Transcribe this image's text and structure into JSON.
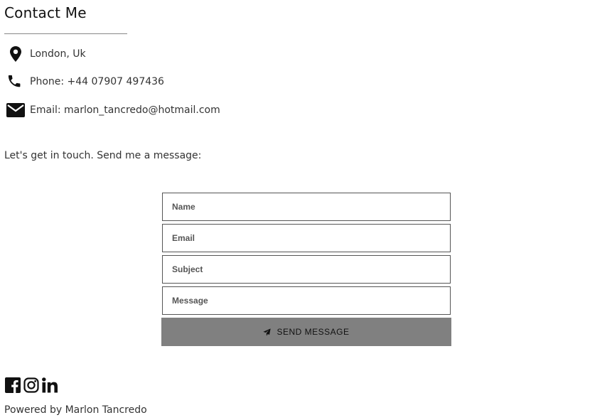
{
  "contact": {
    "title": "Contact Me",
    "location": {
      "icon": "map-marker-icon",
      "text": "London, Uk"
    },
    "phone": {
      "icon": "phone-icon",
      "text": "Phone: +44 07907 497436"
    },
    "email": {
      "icon": "envelope-icon",
      "text": "Email: marlon_tancredo@hotmail.com"
    }
  },
  "intro": "Let's get in touch. Send me a message:",
  "form": {
    "name_placeholder": "Name",
    "email_placeholder": "Email",
    "subject_placeholder": "Subject",
    "message_placeholder": "Message",
    "send_label": "SEND MESSAGE",
    "send_icon": "paper-plane-icon",
    "button_color": "#808080"
  },
  "social": [
    {
      "icon": "facebook-icon"
    },
    {
      "icon": "instagram-icon"
    },
    {
      "icon": "linkedin-icon"
    }
  ],
  "footer": {
    "text": "Powered by Marlon Tancredo"
  }
}
